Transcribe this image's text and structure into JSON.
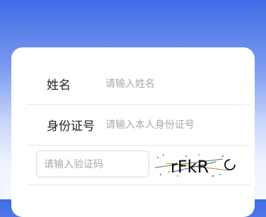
{
  "form": {
    "name_label": "姓名",
    "name_placeholder": "请输入姓名",
    "id_label": "身份证号",
    "id_placeholder": "请输入本人身份证号",
    "captcha_placeholder": "请输入验证码",
    "captcha_text": "rFkR",
    "captcha_refresh_icon": "refresh-icon"
  }
}
